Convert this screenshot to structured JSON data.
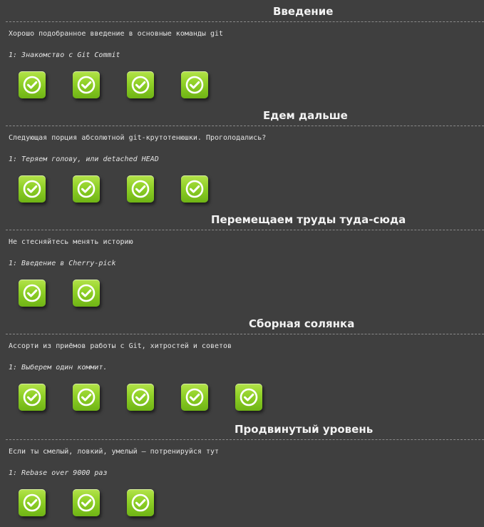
{
  "sections": [
    {
      "title": "Введение",
      "description": "Хорошо подобранное введение в основные команды git",
      "current_level": "1: Знакомство с Git Commit",
      "levels_completed": 4,
      "icon": "check-icon"
    },
    {
      "title": "Едем дальше",
      "description": "Следующая порция абсолютной git-крутотенюшки. Проголодались?",
      "current_level": "1: Теряем голову, или detached HEAD",
      "levels_completed": 4,
      "icon": "check-icon"
    },
    {
      "title": "Перемещаем труды туда-сюда",
      "description": "Не стесняйтесь менять историю",
      "current_level": "1: Введение в Cherry-pick",
      "levels_completed": 2,
      "icon": "check-icon"
    },
    {
      "title": "Сборная солянка",
      "description": "Ассорти из приёмов работы с Git, хитростей и советов",
      "current_level": "1: Выберем один коммит.",
      "levels_completed": 5,
      "icon": "check-icon"
    },
    {
      "title": "Продвинутый уровень",
      "description": "Если ты смелый, ловкий, умелый – потренируйся тут",
      "current_level": "1: Rebase over 9000 раз",
      "levels_completed": 3,
      "icon": "check-icon"
    }
  ],
  "colors": {
    "background": "#3f3f3f",
    "button_green": "#8fd027",
    "divider": "#8a8a8a"
  }
}
